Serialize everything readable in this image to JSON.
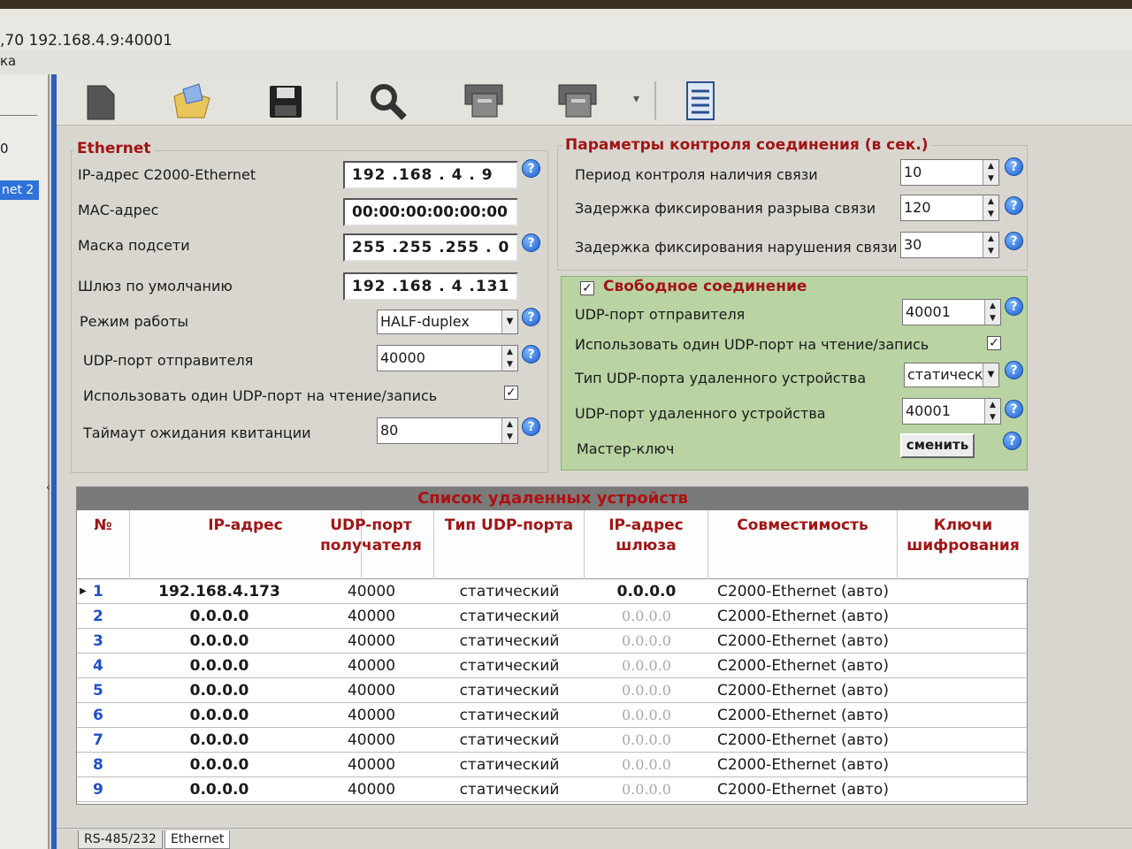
{
  "window": {
    "title": ",70 192.168.4.9:40001",
    "menu_text": "ка"
  },
  "left_panel": {
    "item0": "0",
    "selected_item": "net 2"
  },
  "toolbar": {
    "icons": [
      "file-icon",
      "open-folder-icon",
      "save-icon",
      "search-icon",
      "device-read-icon",
      "device-write-icon",
      "dropdown-arrow-icon",
      "report-icon"
    ]
  },
  "ethernet": {
    "title": "Ethernet",
    "ip_label": "IP-адрес С2000-Ethernet",
    "ip_value": "192 .168 .  4   .  9",
    "mac_label": "МАС-адрес",
    "mac_value": "00:00:00:00:00:00",
    "mask_label": "Маска подсети",
    "mask_value": "255 .255 .255 .  0",
    "gateway_label": "Шлюз по умолчанию",
    "gateway_value": "192 .168 .  4   .131",
    "mode_label": "Режим работы",
    "mode_value": "HALF-duplex",
    "udp_sender_label": "UDP-порт отправителя",
    "udp_sender_value": "40000",
    "single_port_label": "Использовать один UDP-порт на чтение/запись",
    "single_port_checked": true,
    "timeout_label": "Таймаут ожидания квитанции",
    "timeout_value": "80"
  },
  "control": {
    "title": "Параметры контроля соединения (в сек.)",
    "period_label": "Период контроля наличия связи",
    "period_value": "10",
    "break_delay_label": "Задержка фиксирования разрыва связи",
    "break_delay_value": "120",
    "violation_delay_label": "Задержка фиксирования нарушения связи",
    "violation_delay_value": "30"
  },
  "free_conn": {
    "title": "Свободное соединение",
    "enabled": true,
    "udp_sender_label": "UDP-порт отправителя",
    "udp_sender_value": "40001",
    "single_port_label": "Использовать один UDP-порт на чтение/запись",
    "single_port_checked": true,
    "remote_type_label": "Тип UDP-порта удаленного устройства",
    "remote_type_value": "статическ",
    "remote_port_label": "UDP-порт удаленного устройства",
    "remote_port_value": "40001",
    "master_key_label": "Мастер-ключ",
    "change_button": "сменить"
  },
  "table": {
    "caption": "Список удаленных устройств",
    "headers": {
      "num": "№",
      "ip": "IP-адрес",
      "udp_line1": "UDP-порт",
      "udp_line2": "получателя",
      "type": "Тип UDP-порта",
      "gw_line1": "IP-адрес",
      "gw_line2": "шлюза",
      "compat": "Совместимость",
      "keys_line1": "Ключи",
      "keys_line2": "шифрования"
    },
    "rows": [
      {
        "num": "1",
        "ip": "192.168.4.173",
        "port": "40000",
        "type": "статический",
        "gw": "0.0.0.0",
        "compat": "С2000-Ethernet (авто)"
      },
      {
        "num": "2",
        "ip": "0.0.0.0",
        "port": "40000",
        "type": "статический",
        "gw": "0.0.0.0",
        "compat": "С2000-Ethernet (авто)"
      },
      {
        "num": "3",
        "ip": "0.0.0.0",
        "port": "40000",
        "type": "статический",
        "gw": "0.0.0.0",
        "compat": "С2000-Ethernet (авто)"
      },
      {
        "num": "4",
        "ip": "0.0.0.0",
        "port": "40000",
        "type": "статический",
        "gw": "0.0.0.0",
        "compat": "С2000-Ethernet (авто)"
      },
      {
        "num": "5",
        "ip": "0.0.0.0",
        "port": "40000",
        "type": "статический",
        "gw": "0.0.0.0",
        "compat": "С2000-Ethernet (авто)"
      },
      {
        "num": "6",
        "ip": "0.0.0.0",
        "port": "40000",
        "type": "статический",
        "gw": "0.0.0.0",
        "compat": "С2000-Ethernet (авто)"
      },
      {
        "num": "7",
        "ip": "0.0.0.0",
        "port": "40000",
        "type": "статический",
        "gw": "0.0.0.0",
        "compat": "С2000-Ethernet (авто)"
      },
      {
        "num": "8",
        "ip": "0.0.0.0",
        "port": "40000",
        "type": "статический",
        "gw": "0.0.0.0",
        "compat": "С2000-Ethernet (авто)"
      },
      {
        "num": "9",
        "ip": "0.0.0.0",
        "port": "40000",
        "type": "статический",
        "gw": "0.0.0.0",
        "compat": "С2000-Ethernet (авто)"
      }
    ]
  },
  "tabs": [
    "RS-485/232",
    "Ethernet"
  ],
  "colors": {
    "accent_red": "#a01515",
    "green_panel": "#b9d3a3",
    "selection_blue": "#2f73d8"
  }
}
